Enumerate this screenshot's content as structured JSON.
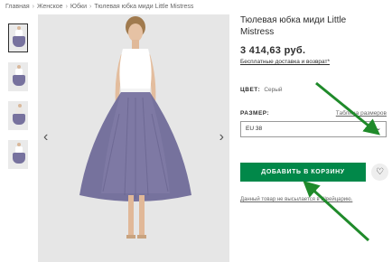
{
  "breadcrumb": [
    "Главная",
    "Женское",
    "Юбки",
    "Тюлевая юбка миди Little Mistress"
  ],
  "breadcrumb_separator": "›",
  "gallery": {
    "prev_glyph": "‹",
    "next_glyph": "›",
    "thumbnail_count": 4,
    "active_thumbnail": 1
  },
  "product": {
    "title": "Тюлевая юбка миди Little Mistress",
    "price": "3 414,63 руб.",
    "delivery_link": "Бесплатные доставка и возврат*"
  },
  "color": {
    "label": "ЦВЕТ:",
    "value": "Серый"
  },
  "size": {
    "label": "РАЗМЕР:",
    "chart_link": "Таблица размеров",
    "selected": "EU 38"
  },
  "actions": {
    "add_to_cart": "ДОБАВИТЬ В КОРЗИНУ",
    "save_icon": "heart-icon"
  },
  "notice": "Данный товар не высылается в Швейцарию.",
  "colors": {
    "accent_green": "#018849",
    "annotation_arrow": "#1f8a2a",
    "skirt": "#76729d",
    "image_background": "#e6e6e6"
  }
}
